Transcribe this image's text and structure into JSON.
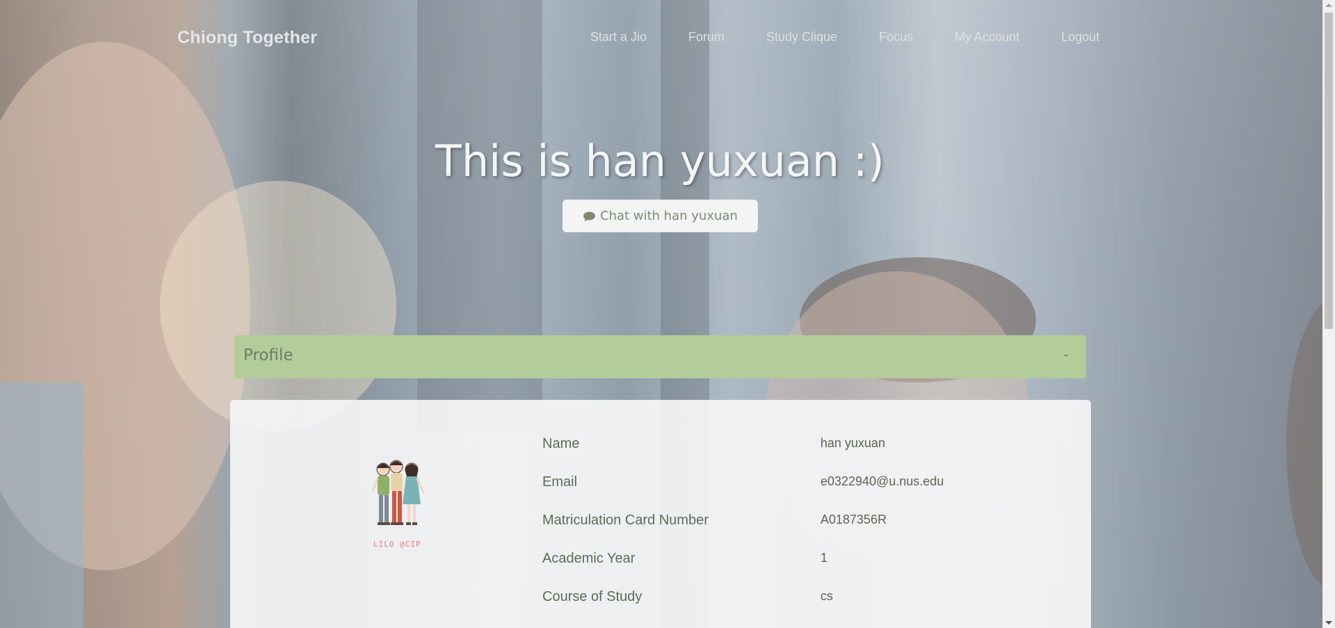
{
  "nav": {
    "brand": "Chiong Together",
    "items": [
      {
        "label": "Start a Jio"
      },
      {
        "label": "Forum"
      },
      {
        "label": "Study Clique"
      },
      {
        "label": "Focus"
      },
      {
        "label": "My Account"
      },
      {
        "label": "Logout"
      }
    ]
  },
  "hero": {
    "title": "This is han yuxuan :)",
    "chat_button": "Chat with han yuxuan"
  },
  "profile": {
    "header_label": "Profile",
    "toggle_label": "-",
    "avatar_caption": "LILO @CIP",
    "fields": [
      {
        "key": "Name",
        "value": "han yuxuan"
      },
      {
        "key": "Email",
        "value": "e0322940@u.nus.edu"
      },
      {
        "key": "Matriculation Card Number",
        "value": "A0187356R"
      },
      {
        "key": "Academic Year",
        "value": "1"
      },
      {
        "key": "Course of Study",
        "value": "cs"
      }
    ]
  },
  "colors": {
    "profile_bar": "#b2cd9a",
    "text_green": "#5d6c55",
    "button_text": "#7b8c74"
  }
}
